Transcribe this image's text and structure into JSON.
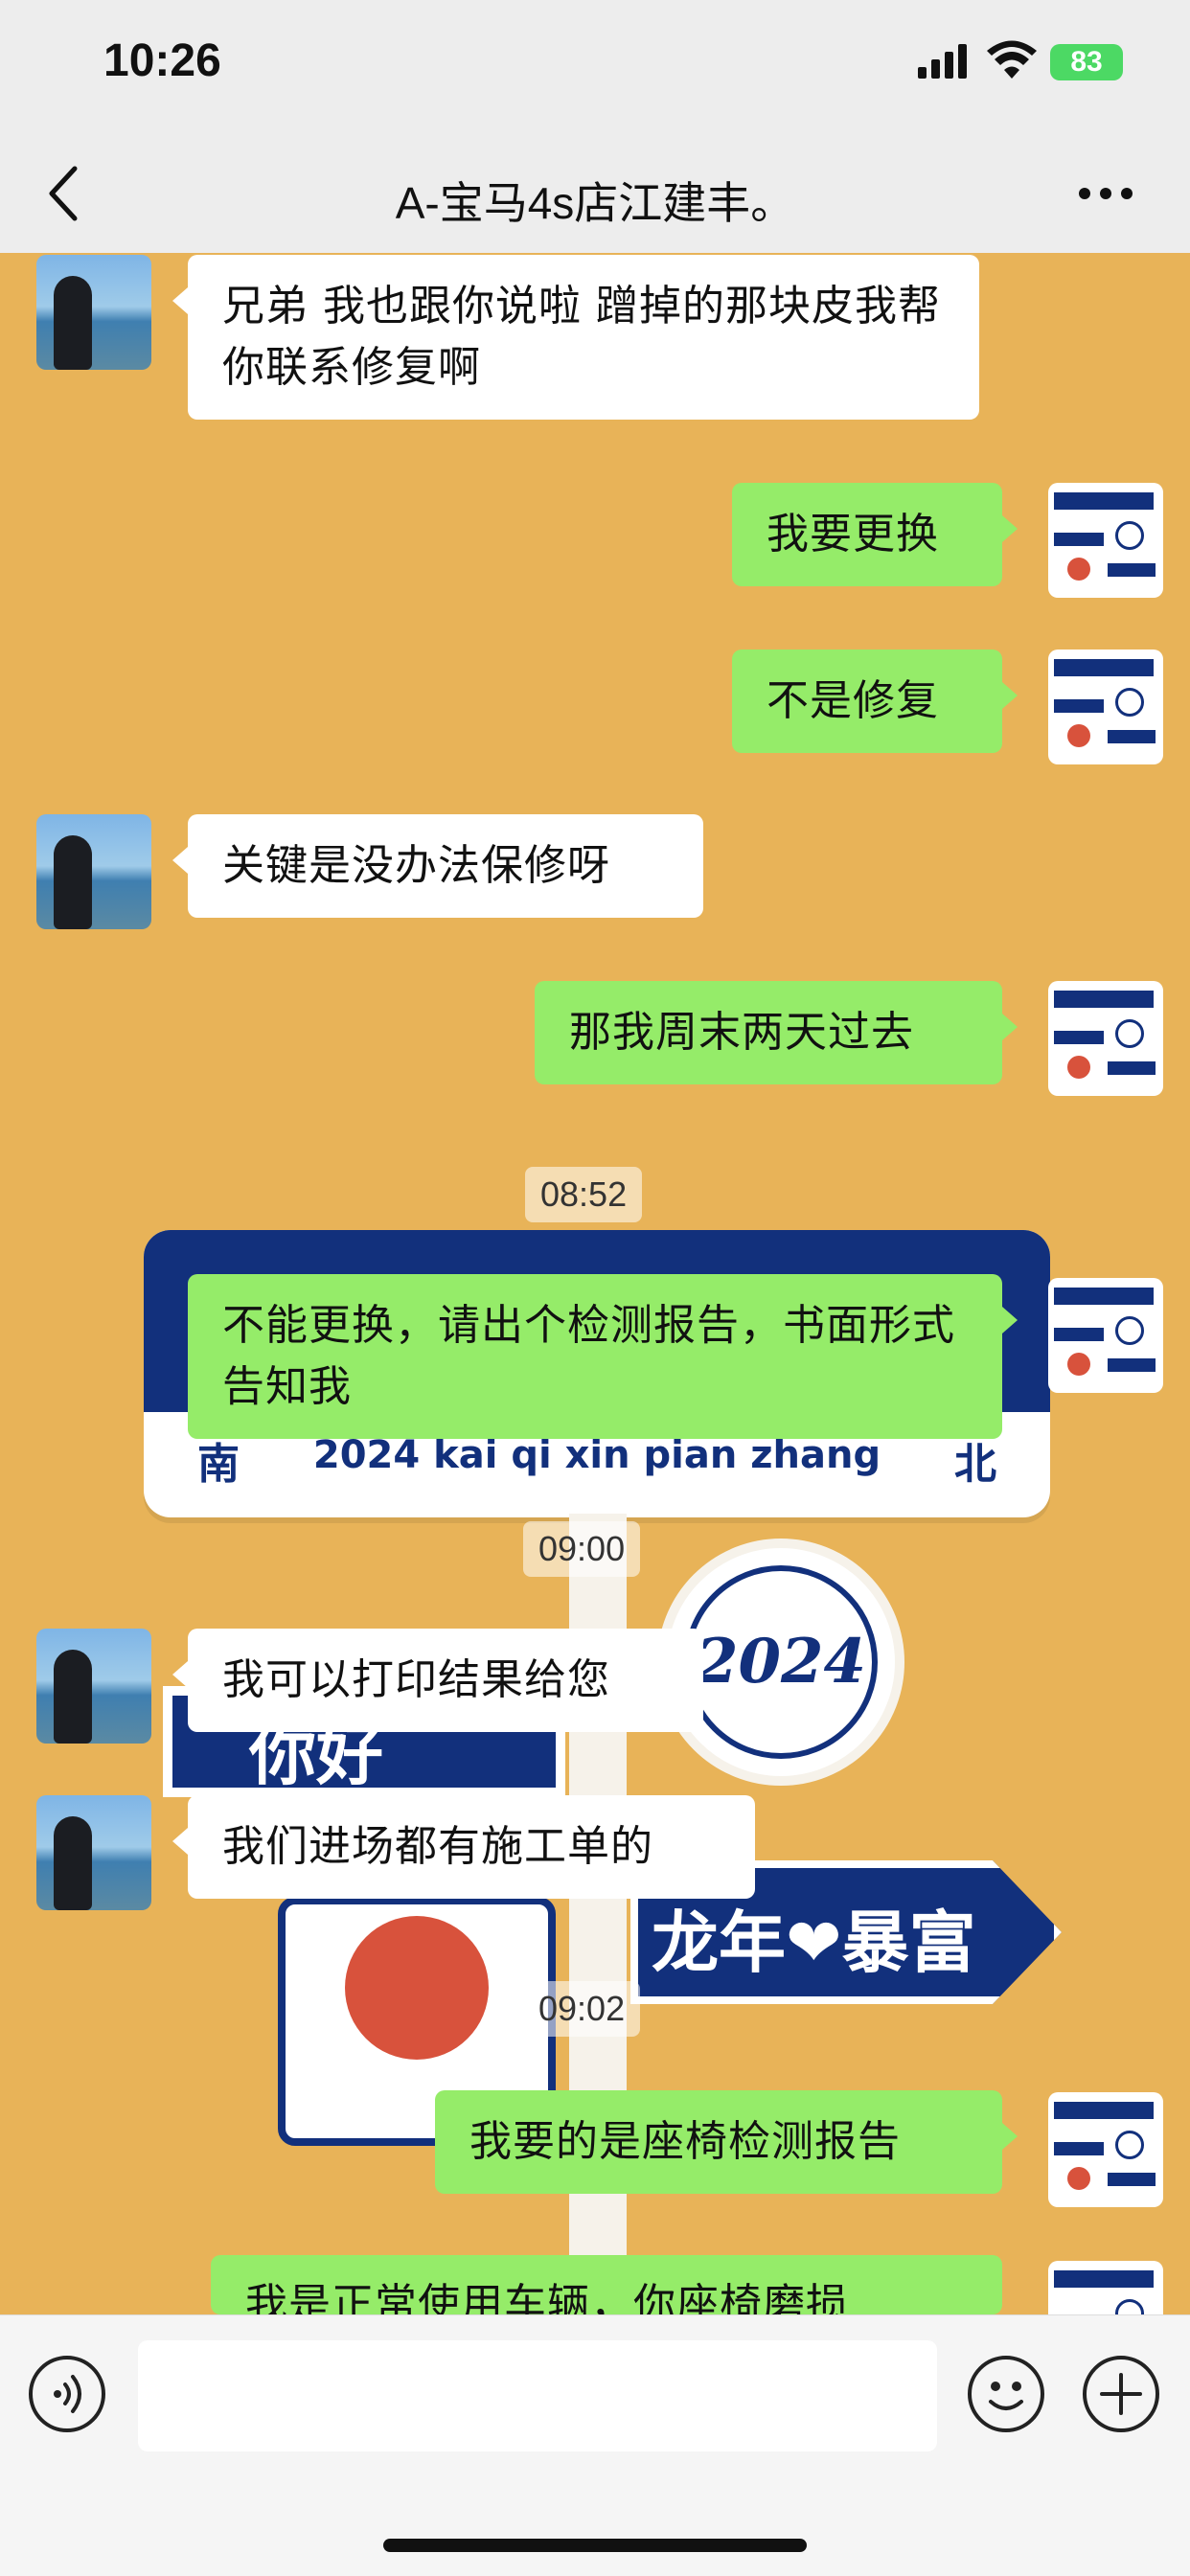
{
  "status": {
    "time": "10:26",
    "battery": "83"
  },
  "nav": {
    "title": "A-宝马4s店江建丰。",
    "back_icon": "chevron-left-icon",
    "more_icon": "more-dots-icon"
  },
  "background_art": {
    "sign_main_text": "2024 kai qi xin pian zhang",
    "sign_south": "南",
    "sign_north": "北",
    "circle_text": "2024",
    "left_sign_text": "你好2024",
    "right_sign_text": "龙年❤暴富"
  },
  "messages": [
    {
      "side": "left",
      "text": "兄弟 我也跟你说啦 蹭掉的那块皮我帮你联系修复啊"
    },
    {
      "side": "right",
      "text": "我要更换"
    },
    {
      "side": "right",
      "text": "不是修复"
    },
    {
      "side": "left",
      "text": "关键是没办法保修呀"
    },
    {
      "side": "right",
      "text": "那我周末两天过去"
    },
    {
      "side": "right",
      "text": "不能更换，请出个检测报告，书面形式告知我"
    },
    {
      "side": "left",
      "text": "我可以打印结果给您"
    },
    {
      "side": "left",
      "text": "我们进场都有施工单的"
    },
    {
      "side": "right",
      "text": "我要的是座椅检测报告"
    },
    {
      "side": "right",
      "text": "我是正常使用车辆，你座椅磨损"
    }
  ],
  "timestamps": [
    "08:52",
    "09:00",
    "09:02"
  ],
  "input": {
    "placeholder": "",
    "voice_icon": "voice-icon",
    "emoji_icon": "emoji-icon",
    "plus_icon": "plus-icon"
  },
  "colors": {
    "chat_background": "#e8b358",
    "sent_bubble": "#95ec69",
    "received_bubble": "#ffffff",
    "bar_background": "#ededed",
    "battery": "#4cd964",
    "sign_navy": "#12307c"
  }
}
